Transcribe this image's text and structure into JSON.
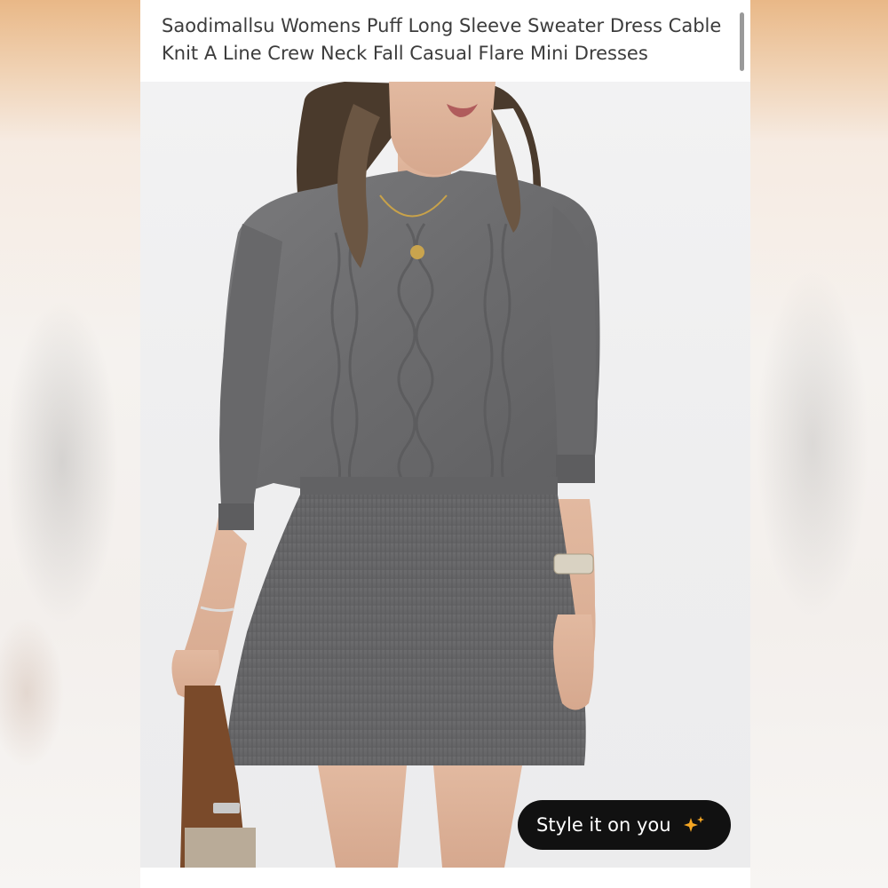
{
  "product": {
    "title": "Saodimallsu Womens Puff Long Sleeve Sweater Dress Cable Knit A Line Crew Neck Fall Casual Flare Mini Dresses"
  },
  "photo": {
    "subject": "Woman wearing a grey cable knit sweater top and ribbed mini skirt"
  },
  "actions": {
    "style_it_label": "Style it on you",
    "style_it_icon": "sparkle-icon"
  },
  "colors": {
    "button_bg": "#111111",
    "button_text": "#ffffff",
    "title_text": "#3c3c3c",
    "sparkle": "#f5a623",
    "sweater": "#6e6e70"
  }
}
